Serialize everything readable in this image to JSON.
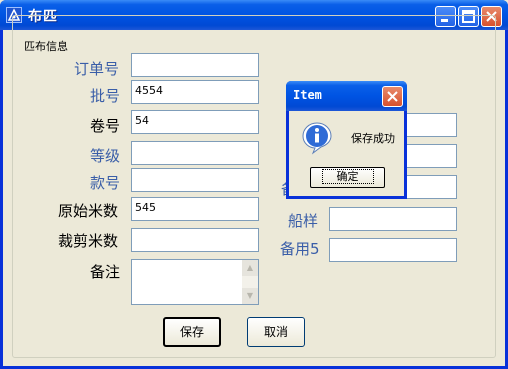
{
  "window": {
    "title": "布匹"
  },
  "group": {
    "title": "匹布信息"
  },
  "form": {
    "order_no": {
      "label": "订单号",
      "value": ""
    },
    "batch_no": {
      "label": "批号",
      "value": "4554"
    },
    "roll_no": {
      "label": "卷号",
      "value": "54"
    },
    "grade": {
      "label": "等级",
      "value": ""
    },
    "style_no": {
      "label": "款号",
      "value": ""
    },
    "original_meters": {
      "label": "原始米数",
      "value": "545"
    },
    "cut_meters": {
      "label": "裁剪米数",
      "value": ""
    },
    "note": {
      "label": "备注",
      "value": ""
    },
    "right_partial_label": "备",
    "ship_sample": {
      "label": "船样",
      "value": ""
    },
    "spare5": {
      "label": "备用5",
      "value": ""
    }
  },
  "buttons": {
    "save": "保存",
    "cancel": "取消"
  },
  "dialog": {
    "title": "Item",
    "message": "保存成功",
    "ok": "确定",
    "icon": "info-icon"
  },
  "colors": {
    "label_blue": "#3a5ea8",
    "titlebar": "#0054e3"
  }
}
